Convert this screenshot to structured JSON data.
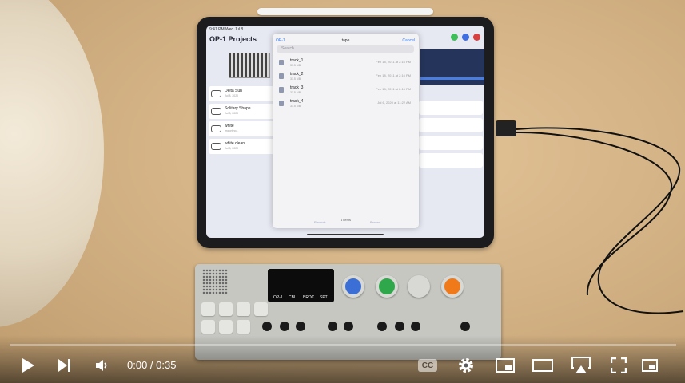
{
  "ipad": {
    "status": "9:41 PM  Wed Jul 8",
    "app_title": "OP-1 Projects",
    "projects": [
      {
        "name": "Delta Sun",
        "sub": "Jul 8, 2020"
      },
      {
        "name": "Solitary Shape",
        "sub": "Jul 8, 2020"
      },
      {
        "name": "white",
        "sub": "importing..."
      },
      {
        "name": "white clean",
        "sub": "Jul 8, 2020"
      }
    ],
    "importing_label": "importing",
    "picker": {
      "back": "OP-1",
      "title": "tape",
      "cancel": "Cancel",
      "search_placeholder": "Search",
      "files": [
        {
          "name": "track_1",
          "size": "31.5 MB",
          "date": "Feb 18, 2011 at 2:16 PM"
        },
        {
          "name": "track_2",
          "size": "31.5 MB",
          "date": "Feb 18, 2011 at 2:16 PM"
        },
        {
          "name": "track_3",
          "size": "31.5 MB",
          "date": "Feb 18, 2011 at 2:16 PM"
        },
        {
          "name": "track_4",
          "size": "31.5 MB",
          "date": "Jul 6, 2020 at 11:22 AM"
        }
      ],
      "count": "4 items",
      "tab_recents": "Recents",
      "tab_browse": "Browse"
    }
  },
  "op1": {
    "display_labels": [
      "OP-1",
      "CBL",
      "BRDC",
      "SPT"
    ],
    "knob_colors": [
      "#3b6fd6",
      "#2ea84a",
      "#d8d8d4",
      "#f07a1a"
    ]
  },
  "player": {
    "time": "0:00 / 0:35",
    "progress": 0,
    "cc_label": "CC"
  }
}
